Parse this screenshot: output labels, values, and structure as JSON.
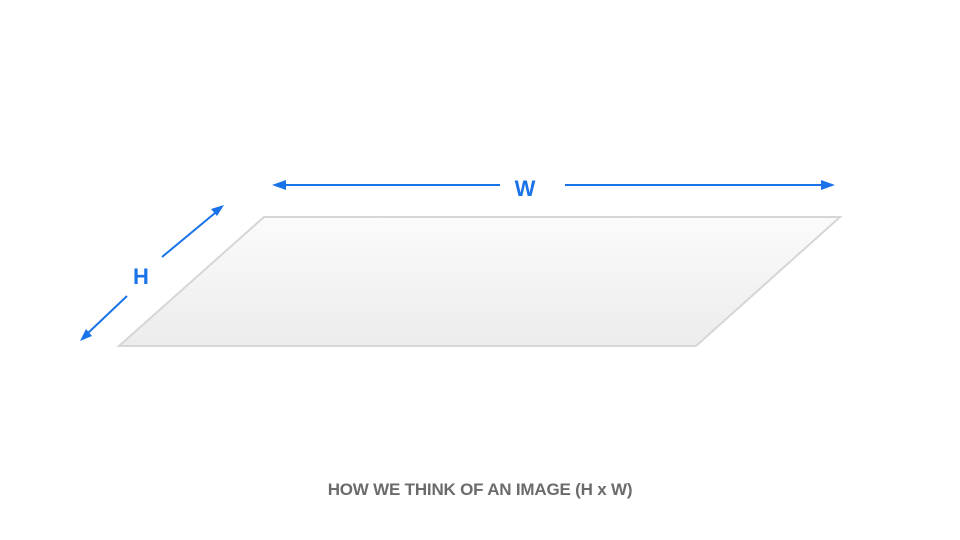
{
  "diagram": {
    "width_label": "W",
    "height_label": "H",
    "caption": "HOW WE THINK OF AN IMAGE (H x W)"
  },
  "colors": {
    "arrow": "#1a73e8",
    "plane_stroke": "#d6d6d6",
    "plane_fill_top": "#fbfbfb",
    "plane_fill_bottom": "#ececec",
    "caption": "#6b6b6b"
  }
}
